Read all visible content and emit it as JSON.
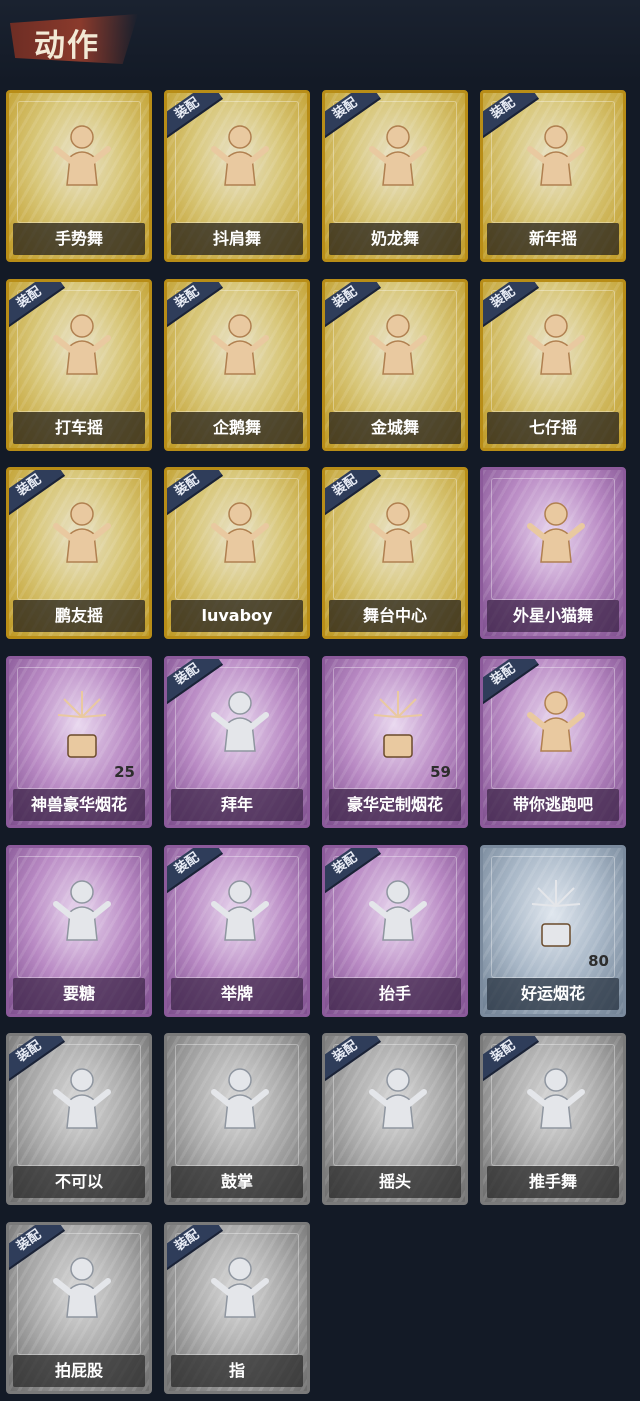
{
  "page": {
    "title": "动作",
    "equip_label": "装配"
  },
  "colors": {
    "gold": "#c6a02c",
    "purple": "#9b6aab",
    "blue": "#8a9bb0",
    "gray": "#8c8c8c",
    "badge": "#2f3d5a"
  },
  "cards": [
    {
      "label": "手势舞",
      "rarity": "gold",
      "equipped": false,
      "icon": "dancer-gesture-icon"
    },
    {
      "label": "抖肩舞",
      "rarity": "gold",
      "equipped": true,
      "icon": "dancer-shoulder-icon"
    },
    {
      "label": "奶龙舞",
      "rarity": "gold",
      "equipped": true,
      "icon": "dancer-face-icon"
    },
    {
      "label": "新年摇",
      "rarity": "gold",
      "equipped": true,
      "icon": "dancer-clap-icon"
    },
    {
      "label": "打车摇",
      "rarity": "gold",
      "equipped": true,
      "icon": "dancer-music-icon"
    },
    {
      "label": "企鹅舞",
      "rarity": "gold",
      "equipped": true,
      "icon": "dancer-penguin-icon"
    },
    {
      "label": "金城舞",
      "rarity": "gold",
      "equipped": true,
      "icon": "dancer-wave-icon"
    },
    {
      "label": "七仔摇",
      "rarity": "gold",
      "equipped": true,
      "icon": "dancer-star-icon"
    },
    {
      "label": "鹏友摇",
      "rarity": "gold",
      "equipped": true,
      "icon": "dancer-swing-icon"
    },
    {
      "label": "luvaboy",
      "rarity": "gold",
      "equipped": true,
      "icon": "dancer-cross-icon"
    },
    {
      "label": "舞台中心",
      "rarity": "gold",
      "equipped": true,
      "icon": "dancer-center-icon"
    },
    {
      "label": "外星小猫舞",
      "rarity": "purple",
      "equipped": false,
      "icon": "dancer-alien-cat-icon"
    },
    {
      "label": "神兽豪华烟花",
      "rarity": "purple",
      "equipped": false,
      "icon": "fireworks-box-icon",
      "count": "25"
    },
    {
      "label": "拜年",
      "rarity": "purple",
      "equipped": true,
      "icon": "figure-greeting-icon"
    },
    {
      "label": "豪华定制烟花",
      "rarity": "purple",
      "equipped": false,
      "icon": "fireworks-crate-icon",
      "count": "59"
    },
    {
      "label": "带你逃跑吧",
      "rarity": "purple",
      "equipped": true,
      "icon": "dancer-run-icon"
    },
    {
      "label": "要糖",
      "rarity": "purple",
      "equipped": false,
      "icon": "figure-candy-icon"
    },
    {
      "label": "举牌",
      "rarity": "purple",
      "equipped": true,
      "icon": "figure-sign-icon"
    },
    {
      "label": "抬手",
      "rarity": "purple",
      "equipped": true,
      "icon": "figure-raise-hand-icon"
    },
    {
      "label": "好运烟花",
      "rarity": "blue",
      "equipped": false,
      "icon": "firework-can-icon",
      "count": "80"
    },
    {
      "label": "不可以",
      "rarity": "gray",
      "equipped": true,
      "icon": "finger-no-icon"
    },
    {
      "label": "鼓掌",
      "rarity": "gray",
      "equipped": false,
      "icon": "clapping-hands-icon"
    },
    {
      "label": "摇头",
      "rarity": "gray",
      "equipped": true,
      "icon": "figure-shake-head-icon"
    },
    {
      "label": "推手舞",
      "rarity": "gray",
      "equipped": true,
      "icon": "figure-push-hand-icon"
    },
    {
      "label": "拍屁股",
      "rarity": "gray",
      "equipped": true,
      "icon": "figure-pat-icon"
    },
    {
      "label": "指",
      "rarity": "gray",
      "equipped": true,
      "icon": "pointing-hand-icon"
    }
  ]
}
